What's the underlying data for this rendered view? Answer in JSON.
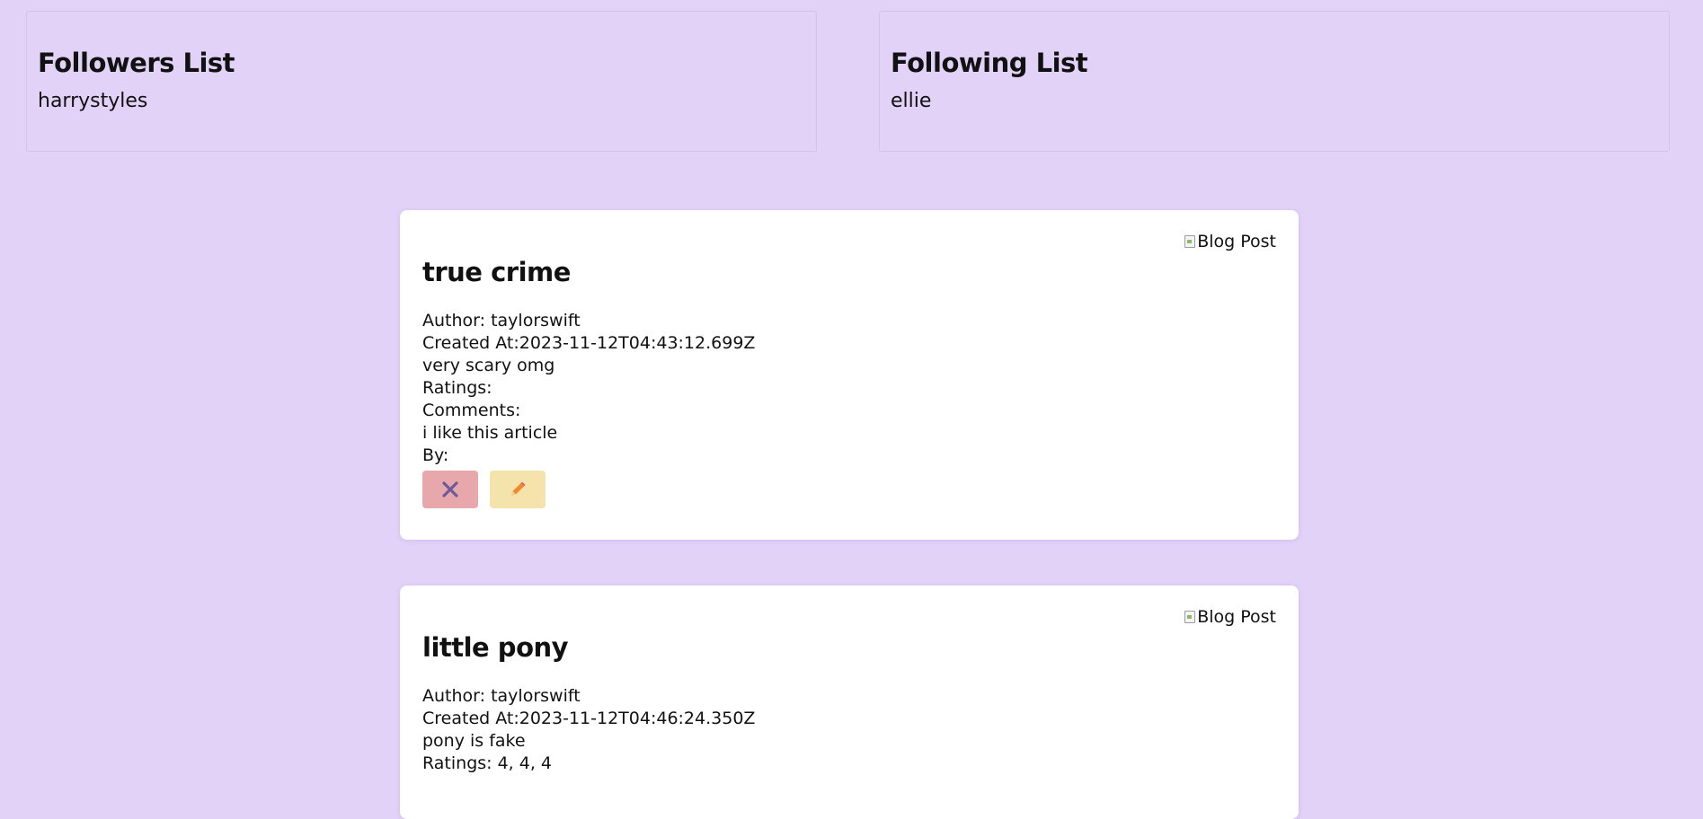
{
  "followers": {
    "title": "Followers List",
    "items": [
      "harrystyles"
    ]
  },
  "following": {
    "title": "Following List",
    "items": [
      "ellie"
    ]
  },
  "posts": [
    {
      "image_alt": "Blog Post",
      "title": "true crime",
      "author": "Author: taylorswift",
      "created": "Created At:2023-11-12T04:43:12.699Z",
      "body": "very scary omg",
      "ratings": "Ratings:",
      "comments_label": "Comments:",
      "comment": "i like this article",
      "by": "By:",
      "delete_icon": "close-icon",
      "edit_icon": "pencil-icon"
    },
    {
      "image_alt": "Blog Post",
      "title": "little pony",
      "author": "Author: taylorswift",
      "created": "Created At:2023-11-12T04:46:24.350Z",
      "body": "pony is fake",
      "ratings": "Ratings: 4, 4, 4"
    }
  ],
  "colors": {
    "background": "#e2d2f8",
    "card": "#ffffff",
    "delete_button": "#e8a8ab",
    "edit_button": "#f4e3ab",
    "delete_icon": "#6b5b9a",
    "edit_icon": "#f08a2a"
  }
}
